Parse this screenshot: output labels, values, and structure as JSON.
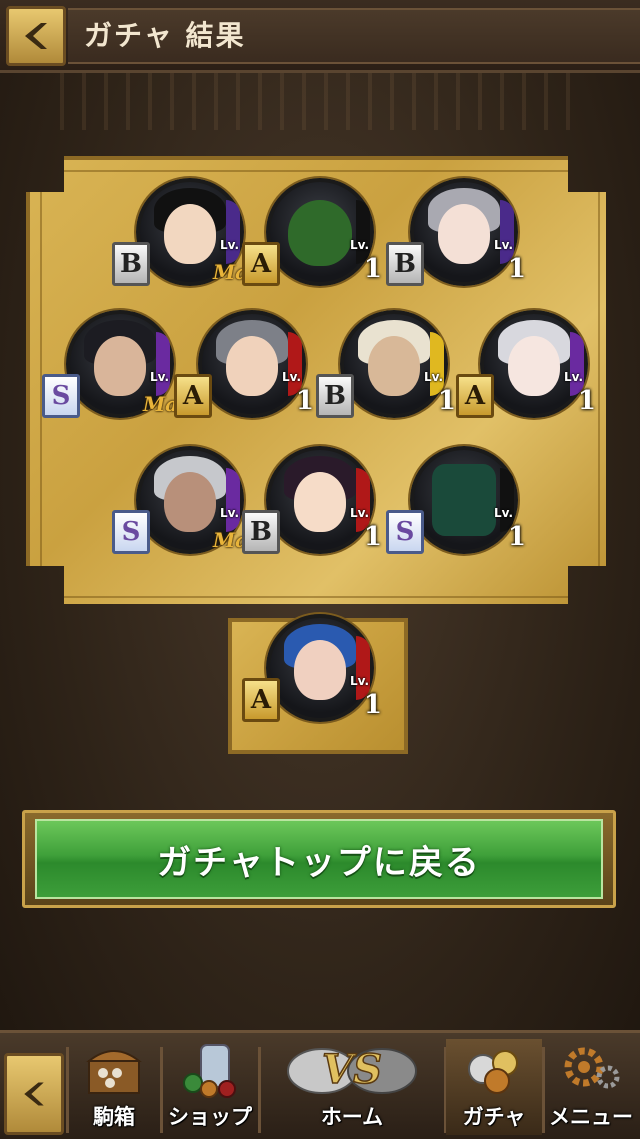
{
  "header": {
    "title": "ガチャ 結果"
  },
  "colors": {
    "accent_green": "#3fa03a",
    "gold": "#caa140",
    "max_text": "#e8b43a"
  },
  "results": [
    {
      "rank": "B",
      "level_label": "Lv.",
      "level": "Max",
      "icon": "black-hair-boy-portrait"
    },
    {
      "rank": "A",
      "level_label": "Lv.",
      "level": "1",
      "icon": "green-dragon-portrait"
    },
    {
      "rank": "B",
      "level_label": "Lv.",
      "level": "1",
      "icon": "silver-hair-girl-portrait"
    },
    {
      "rank": "S",
      "level_label": "Lv.",
      "level": "Max",
      "icon": "eyepatch-man-portrait"
    },
    {
      "rank": "A",
      "level_label": "Lv.",
      "level": "1",
      "icon": "horned-man-portrait"
    },
    {
      "rank": "B",
      "level_label": "Lv.",
      "level": "1",
      "icon": "hooded-man-portrait"
    },
    {
      "rank": "A",
      "level_label": "Lv.",
      "level": "1",
      "icon": "white-hair-girl-portrait"
    },
    {
      "rank": "S",
      "level_label": "Lv.",
      "level": "Max",
      "icon": "sunglasses-man-portrait"
    },
    {
      "rank": "B",
      "level_label": "Lv.",
      "level": "1",
      "icon": "kimono-girl-portrait"
    },
    {
      "rank": "S",
      "level_label": "Lv.",
      "level": "1",
      "icon": "green-mecha-portrait"
    }
  ],
  "bonus": {
    "rank": "A",
    "level_label": "Lv.",
    "level": "1",
    "icon": "blue-hair-demon-portrait"
  },
  "main_button": {
    "label": "ガチャトップに戻る"
  },
  "nav": [
    {
      "label": "駒箱",
      "icon": "treasure-chest-icon"
    },
    {
      "label": "ショップ",
      "icon": "coin-jar-icon"
    },
    {
      "label": "ホーム",
      "icon": "vs-home-icon"
    },
    {
      "label": "ガチャ",
      "icon": "gacha-coins-icon"
    },
    {
      "label": "メニュー",
      "icon": "gears-icon"
    }
  ]
}
